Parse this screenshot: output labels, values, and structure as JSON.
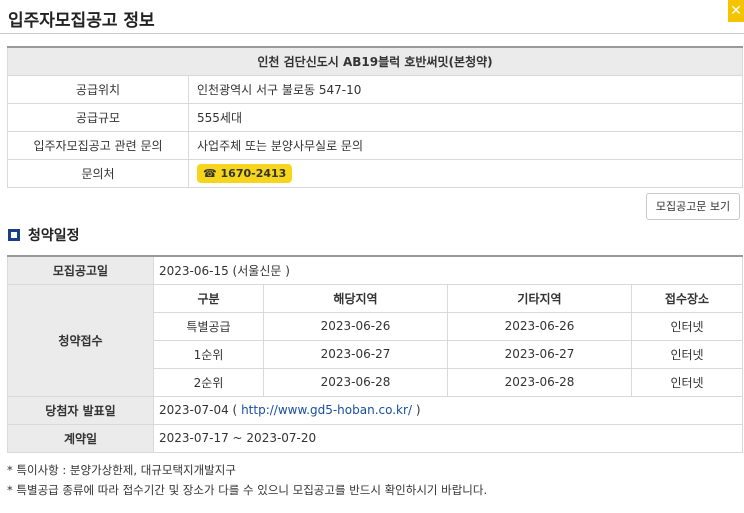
{
  "page_title": "입주자모집공고 정보",
  "close_icon": "close-icon",
  "info": {
    "heading": "인천 검단신도시 AB19블럭 호반써밋(본청약)",
    "rows": [
      {
        "label": "공급위치",
        "value": "인천광역시 서구 불로동 547-10"
      },
      {
        "label": "공급규모",
        "value": "555세대"
      },
      {
        "label": "입주자모집공고 관련 문의",
        "value": "사업주체 또는 분양사무실로 문의"
      },
      {
        "label": "문의처",
        "value": "☎ 1670-2413"
      }
    ]
  },
  "view_button": "모집공고문 보기",
  "section_title": "청약일정",
  "schedule": {
    "announce_label": "모집공고일",
    "announce_value": "2023-06-15 (서울신문 )",
    "receipt_label": "청약접수",
    "sub_headers": [
      "구분",
      "해당지역",
      "기타지역",
      "접수장소"
    ],
    "rows": [
      [
        "특별공급",
        "2023-06-26",
        "2023-06-26",
        "인터넷"
      ],
      [
        "1순위",
        "2023-06-27",
        "2023-06-27",
        "인터넷"
      ],
      [
        "2순위",
        "2023-06-28",
        "2023-06-28",
        "인터넷"
      ]
    ],
    "winner_label": "당첨자 발표일",
    "winner_date": "2023-07-04 ( ",
    "winner_link": "http://www.gd5-hoban.co.kr/",
    "winner_close": " )",
    "contract_label": "계약일",
    "contract_value": "2023-07-17 ~ 2023-07-20"
  },
  "notes": [
    "* 특이사항 : 분양가상한제, 대규모택지개발지구",
    "* 특별공급 종류에 따라 접수기간 및 장소가 다를 수 있으니 모집공고를 반드시 확인하시기 바랍니다."
  ]
}
